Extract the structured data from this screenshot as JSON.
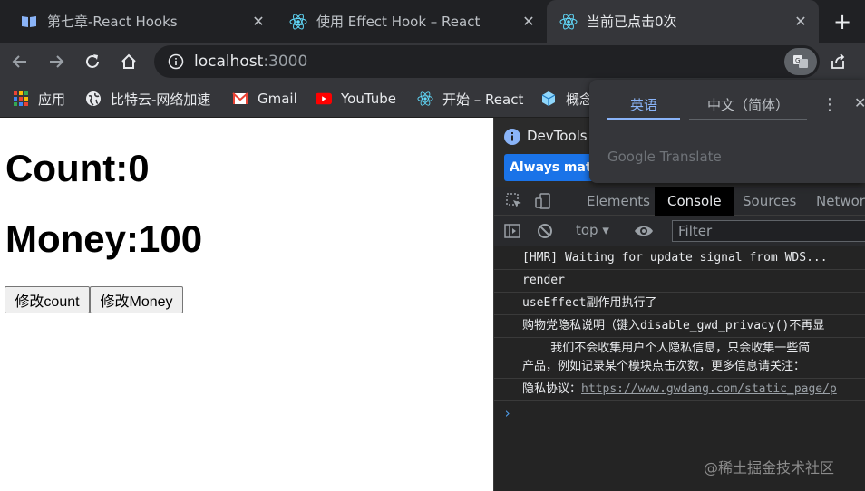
{
  "tabs": [
    {
      "title": "第七章-React Hooks",
      "icon": "book-icon"
    },
    {
      "title": "使用 Effect Hook – React",
      "icon": "react-icon"
    },
    {
      "title": "当前已点击0次",
      "icon": "react-icon",
      "active": true
    }
  ],
  "toolbar": {
    "url_host": "localhost",
    "url_port": ":3000"
  },
  "bookmarks": [
    {
      "label": "应用",
      "icon": "apps-grid-icon"
    },
    {
      "label": "比特云-网络加速",
      "icon": "globe-icon"
    },
    {
      "label": "Gmail",
      "icon": "gmail-icon"
    },
    {
      "label": "YouTube",
      "icon": "youtube-icon"
    },
    {
      "label": "开始 – React",
      "icon": "react-icon"
    },
    {
      "label": "概念",
      "icon": "cube-icon"
    }
  ],
  "page": {
    "count_text": "Count:0",
    "money_text": "Money:100",
    "btn_count": "修改count",
    "btn_money": "修改Money"
  },
  "devtools": {
    "info_text": "DevTools is",
    "always_match_btn": "Always match",
    "tabs": [
      "Elements",
      "Console",
      "Sources",
      "Network"
    ],
    "context": "top",
    "filter_placeholder": "Filter",
    "console_lines": [
      "[HMR] Waiting for update signal from WDS...",
      "render",
      "useEffect副作用执行了",
      "购物党隐私说明（键入disable_gwd_privacy()不再显",
      "    我们不会收集用户个人隐私信息，只会收集一些简",
      "产品，例如记录某个模块点击次数，更多信息请关注：",
      "隐私协议："
    ],
    "privacy_link": "https://www.gwdang.com/static_page/p",
    "prompt": "›"
  },
  "translate_popup": {
    "lang_en": "英语",
    "lang_zh": "中文（简体）",
    "brand": "Google Translate"
  },
  "watermark": "@稀土掘金技术社区",
  "colors": {
    "accent": "#8ab4f8",
    "button_blue": "#1a73e8",
    "react": "#61dafb"
  }
}
